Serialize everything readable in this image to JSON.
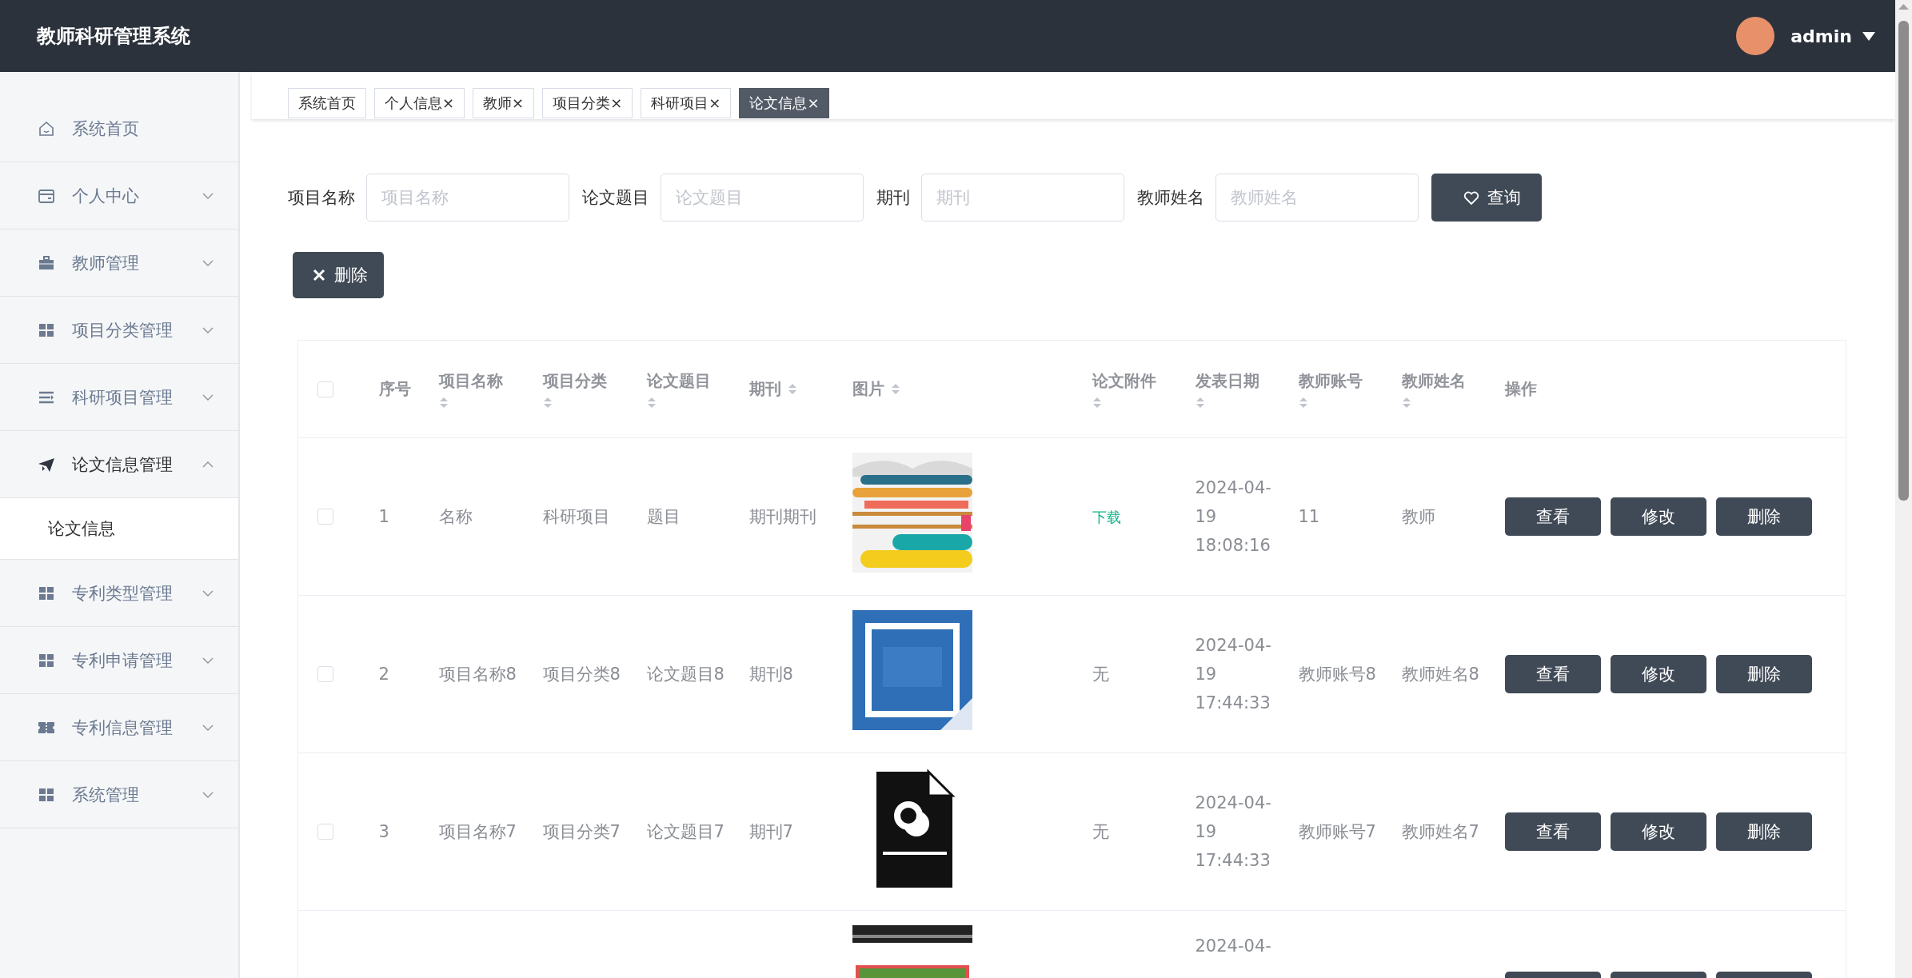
{
  "header": {
    "title": "教师科研管理系统",
    "user": "admin"
  },
  "sidebar": {
    "items": [
      {
        "label": "系统首页",
        "kind": "home"
      },
      {
        "label": "个人中心",
        "kind": "card",
        "expanded": false
      },
      {
        "label": "教师管理",
        "kind": "briefcase",
        "expanded": false
      },
      {
        "label": "项目分类管理",
        "kind": "grid",
        "expanded": false
      },
      {
        "label": "科研项目管理",
        "kind": "lines",
        "expanded": false
      },
      {
        "label": "论文信息管理",
        "kind": "plane",
        "expanded": true,
        "children": [
          {
            "label": "论文信息",
            "selected": true
          }
        ]
      },
      {
        "label": "专利类型管理",
        "kind": "grid",
        "expanded": false
      },
      {
        "label": "专利申请管理",
        "kind": "grid",
        "expanded": false
      },
      {
        "label": "专利信息管理",
        "kind": "ticket",
        "expanded": false
      },
      {
        "label": "系统管理",
        "kind": "grid",
        "expanded": false
      }
    ]
  },
  "tabs": [
    {
      "label": "系统首页",
      "selected": false
    },
    {
      "label": "个人信息",
      "close": "×",
      "selected": false
    },
    {
      "label": "教师",
      "close": "×",
      "selected": false
    },
    {
      "label": "项目分类",
      "close": "×",
      "selected": false
    },
    {
      "label": "科研项目",
      "close": "×",
      "selected": false
    },
    {
      "label": "论文信息",
      "close": "×",
      "selected": true
    }
  ],
  "filters": [
    {
      "label": "项目名称",
      "placeholder": "项目名称"
    },
    {
      "label": "论文题目",
      "placeholder": "论文题目"
    },
    {
      "label": "期刊",
      "placeholder": "期刊"
    },
    {
      "label": "教师姓名",
      "placeholder": "教师姓名"
    }
  ],
  "query_button": "查询",
  "delete_button": "删除",
  "table": {
    "columns": [
      {
        "label": "序号",
        "sortable": false
      },
      {
        "label": "项目名称",
        "sortable": true
      },
      {
        "label": "项目分类",
        "sortable": true
      },
      {
        "label": "论文题目",
        "sortable": true
      },
      {
        "label": "期刊",
        "sortable": true
      },
      {
        "label": "图片",
        "sortable": true
      },
      {
        "label": "论文附件",
        "sortable": true
      },
      {
        "label": "发表日期",
        "sortable": true
      },
      {
        "label": "教师账号",
        "sortable": true
      },
      {
        "label": "教师姓名",
        "sortable": true
      },
      {
        "label": "操作",
        "sortable": false
      }
    ],
    "header_checked": false,
    "rows": [
      {
        "checked": false,
        "index": "1",
        "project_name": "名称",
        "project_category": "科研项目",
        "paper_title": "题目",
        "journal": "期刊期刊",
        "image": {
          "kind": "picture"
        },
        "attachment": {
          "text": "下载",
          "kind": "link"
        },
        "publish_date": "2024-04-19 18:08:16",
        "teacher_account": "11",
        "teacher_name": "教师",
        "actions": [
          "查看",
          "修改",
          "删除"
        ]
      },
      {
        "checked": false,
        "index": "2",
        "project_name": "项目名称8",
        "project_category": "项目分类8",
        "paper_title": "论文题目8",
        "journal": "期刊8",
        "image": {
          "kind": "picture"
        },
        "attachment": {
          "text": "无",
          "kind": "plain"
        },
        "publish_date": "2024-04-19 17:44:33",
        "teacher_account": "教师账号8",
        "teacher_name": "教师姓名8",
        "actions": [
          "查看",
          "修改",
          "删除"
        ]
      },
      {
        "checked": false,
        "index": "3",
        "project_name": "项目名称7",
        "project_category": "项目分类7",
        "paper_title": "论文题目7",
        "journal": "期刊7",
        "image": {
          "kind": "picture"
        },
        "attachment": {
          "text": "无",
          "kind": "plain"
        },
        "publish_date": "2024-04-19 17:44:33",
        "teacher_account": "教师账号7",
        "teacher_name": "教师姓名7",
        "actions": [
          "查看",
          "修改",
          "删除"
        ]
      },
      {
        "partial": true,
        "image": {
          "kind": "picture"
        },
        "publish_date": "2024-04-"
      }
    ]
  }
}
